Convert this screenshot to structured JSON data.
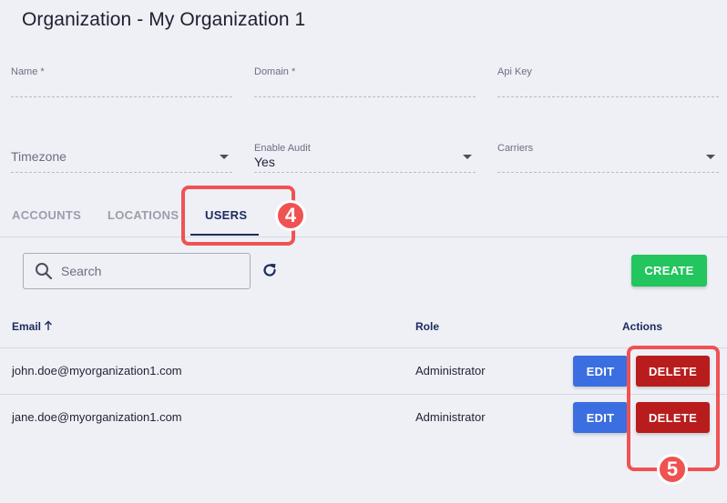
{
  "page": {
    "title": "Organization - My Organization 1"
  },
  "form": {
    "name": {
      "label": "Name *",
      "value": ""
    },
    "domain": {
      "label": "Domain *",
      "value": ""
    },
    "api_key": {
      "label": "Api Key",
      "value": ""
    },
    "timezone": {
      "placeholder": "Timezone",
      "value": ""
    },
    "enable_audit": {
      "label": "Enable Audit",
      "value": "Yes"
    },
    "carriers": {
      "label": "Carriers",
      "value": ""
    }
  },
  "tabs": [
    {
      "label": "ACCOUNTS",
      "active": false
    },
    {
      "label": "LOCATIONS",
      "active": false
    },
    {
      "label": "USERS",
      "active": true
    }
  ],
  "toolbar": {
    "search_placeholder": "Search",
    "create_label": "CREATE",
    "refresh_icon": "refresh-icon"
  },
  "table": {
    "headers": {
      "email": "Email",
      "role": "Role",
      "actions": "Actions"
    },
    "sort": {
      "column": "email",
      "direction": "ascending"
    },
    "rows": [
      {
        "email": "john.doe@myorganization1.com",
        "role": "Administrator",
        "edit_label": "EDIT",
        "delete_label": "DELETE"
      },
      {
        "email": "jane.doe@myorganization1.com",
        "role": "Administrator",
        "edit_label": "EDIT",
        "delete_label": "DELETE"
      }
    ]
  },
  "annotations": [
    {
      "label": "4"
    },
    {
      "label": "5"
    }
  ],
  "colors": {
    "background": "#eef0f6",
    "accent": "#1d2a5c",
    "create": "#22c55e",
    "edit": "#3b6ee0",
    "delete": "#b91c1c",
    "annotation": "#f05252"
  }
}
